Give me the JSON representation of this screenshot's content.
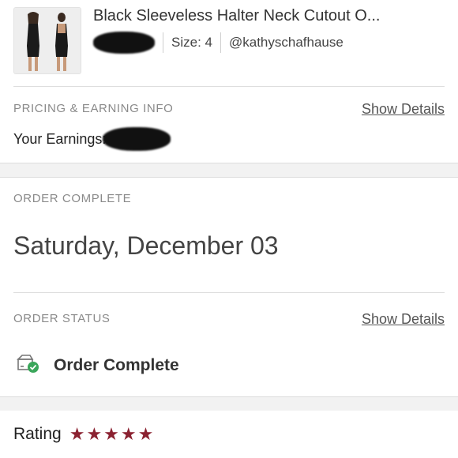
{
  "item": {
    "title": "Black Sleeveless Halter Neck Cutout O...",
    "size": "Size: 4",
    "seller": "@kathyschafhause"
  },
  "pricing": {
    "label": "PRICING & EARNING INFO",
    "show_details": "Show Details",
    "earnings_label": "Your Earnings:"
  },
  "order_complete": {
    "label": "ORDER COMPLETE",
    "date": "Saturday, December 03"
  },
  "order_status": {
    "label": "ORDER STATUS",
    "show_details": "Show Details",
    "status": "Order Complete",
    "icon": "package-check-icon",
    "check_color": "#3aa65a"
  },
  "rating": {
    "label": "Rating",
    "stars": 5,
    "max_stars": 5,
    "star_color": "#8b2231"
  }
}
